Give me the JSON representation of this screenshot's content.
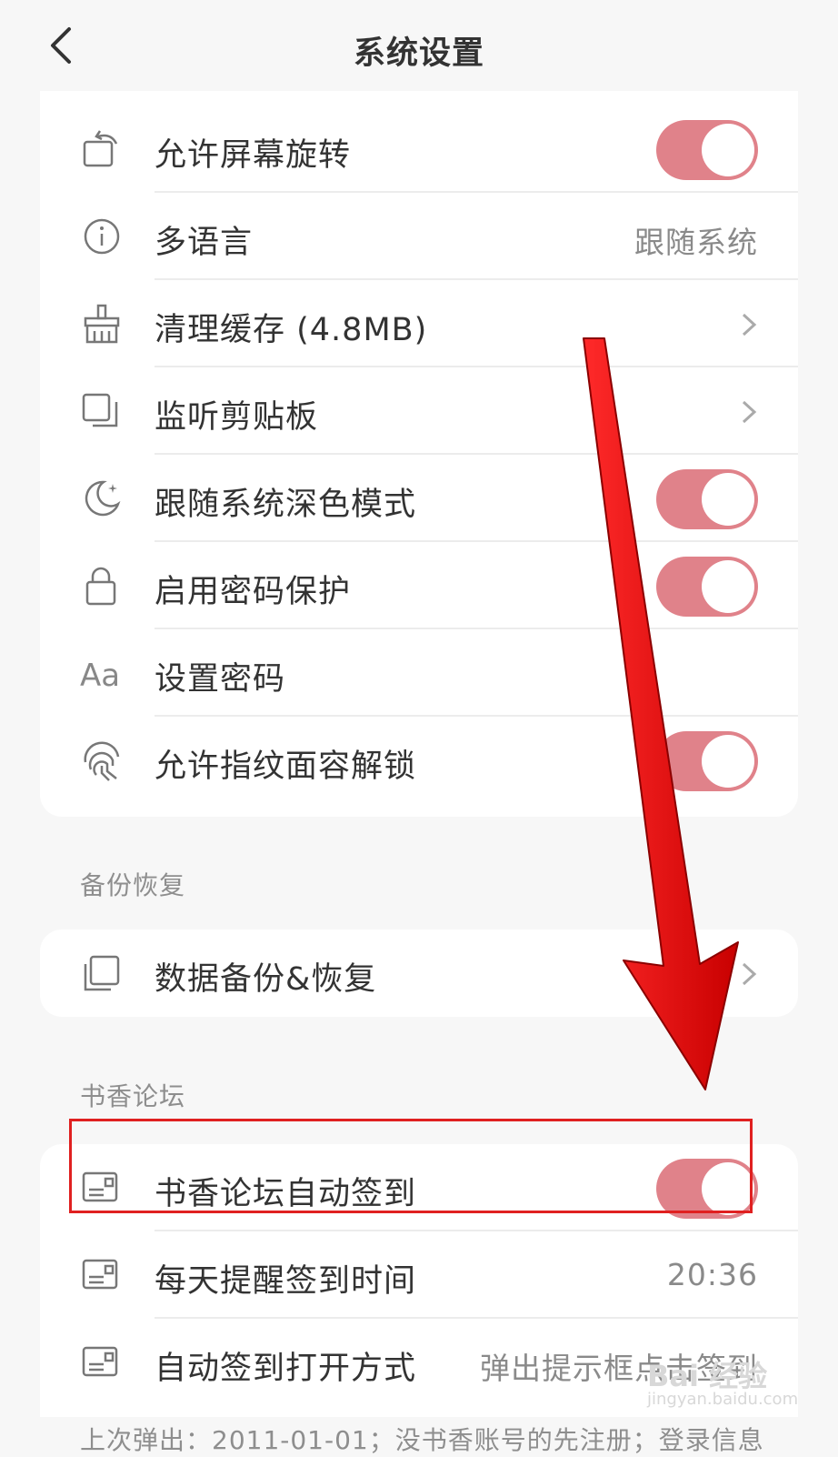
{
  "header": {
    "title": "系统设置",
    "back_icon": "chevron-left-icon"
  },
  "settings": {
    "rows": [
      {
        "label": "允许屏幕旋转",
        "icon": "rotate-screen-icon",
        "control": "toggle",
        "on": true
      },
      {
        "label": "多语言",
        "icon": "info-icon",
        "control": "value",
        "value": "跟随系统"
      },
      {
        "label": "清理缓存 (4.8MB)",
        "icon": "broom-icon",
        "control": "chevron"
      },
      {
        "label": "监听剪贴板",
        "icon": "clipboard-icon",
        "control": "chevron"
      },
      {
        "label": "跟随系统深色模式",
        "icon": "moon-icon",
        "control": "toggle",
        "on": true
      },
      {
        "label": "启用密码保护",
        "icon": "lock-icon",
        "control": "toggle",
        "on": true
      },
      {
        "label": "设置密码",
        "icon": "font-aa-icon",
        "control": "none"
      },
      {
        "label": "允许指纹面容解锁",
        "icon": "fingerprint-icon",
        "control": "toggle",
        "on": true
      }
    ]
  },
  "backup": {
    "section_title": "备份恢复",
    "rows": [
      {
        "label": "数据备份&恢复",
        "icon": "copy-icon",
        "control": "chevron"
      }
    ]
  },
  "forum": {
    "section_title": "书香论坛",
    "rows": [
      {
        "label": "书香论坛自动签到",
        "icon": "card-icon",
        "control": "toggle",
        "on": true
      },
      {
        "label": "每天提醒签到时间",
        "icon": "card-icon",
        "control": "value",
        "value": "20:36"
      },
      {
        "label": "自动签到打开方式",
        "icon": "card-icon",
        "control": "value",
        "value": "弹出提示框点击签到"
      }
    ],
    "footnote": "上次弹出：2011-01-01；没书香账号的先注册；登录信息"
  },
  "watermark": {
    "brand": "Bai 经验",
    "url": "jingyan.baidu.com"
  },
  "colors": {
    "toggle_on": "#e0828a",
    "annotation": "#e02020",
    "background": "#f7f7f7"
  }
}
